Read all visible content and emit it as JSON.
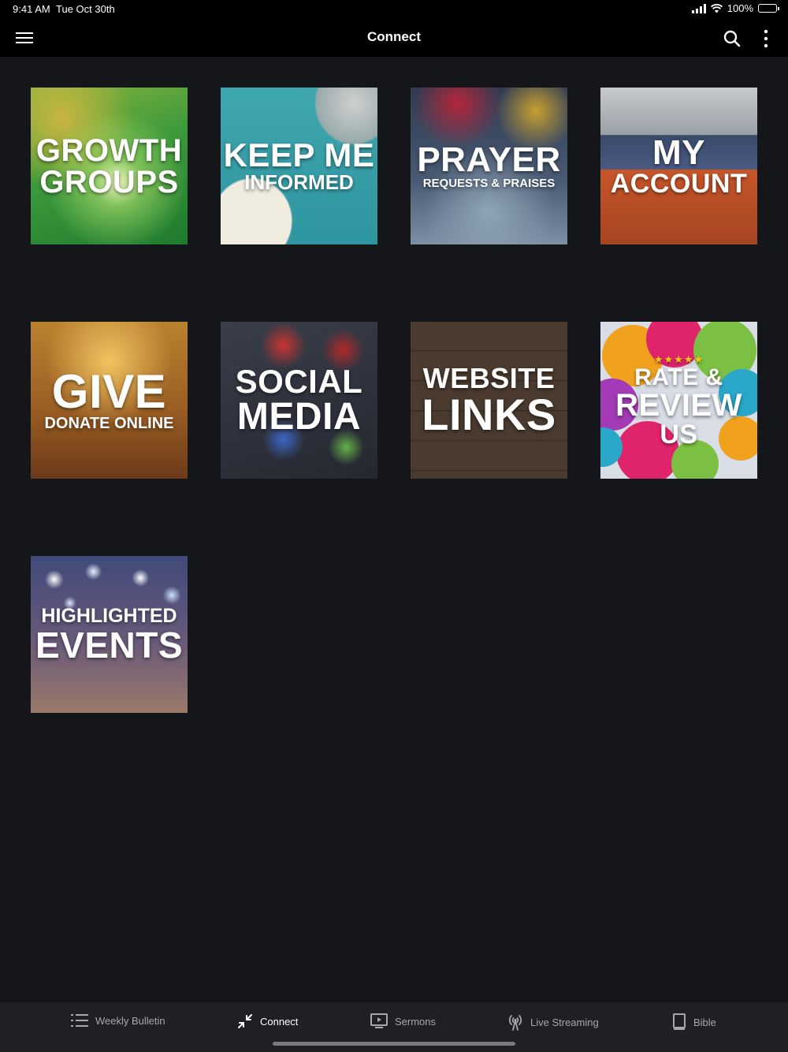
{
  "status_bar": {
    "time": "9:41 AM",
    "date": "Tue Oct 30th",
    "battery": "100%"
  },
  "nav": {
    "title": "Connect",
    "icons": [
      "menu-icon",
      "search-icon",
      "more-vertical-icon"
    ]
  },
  "tiles": [
    {
      "line1": "GROWTH",
      "line2": "GROUPS"
    },
    {
      "line1": "KEEP ME",
      "line2": "INFORMED"
    },
    {
      "line1": "PRAYER",
      "line2": "REQUESTS & PRAISES"
    },
    {
      "line1": "MY",
      "line2": "ACCOUNT"
    },
    {
      "line1": "GIVE",
      "line2": "DONATE ONLINE"
    },
    {
      "line1": "SOCIAL",
      "line2": "MEDIA"
    },
    {
      "line1": "WEBSITE",
      "line2": "LINKS"
    },
    {
      "stars": "★★★★★",
      "line1": "RATE &",
      "line2": "REVIEW",
      "line3": "US"
    },
    {
      "line1": "HIGHLIGHTED",
      "line2": "EVENTS"
    }
  ],
  "tab_bar": {
    "active": "Connect",
    "tabs": [
      {
        "label": "Weekly Bulletin",
        "icon": "list-icon"
      },
      {
        "label": "Connect",
        "icon": "connect-arrows-icon"
      },
      {
        "label": "Sermons",
        "icon": "play-screen-icon"
      },
      {
        "label": "Live Streaming",
        "icon": "broadcast-icon"
      },
      {
        "label": "Bible",
        "icon": "book-icon"
      }
    ]
  },
  "colors": {
    "background": "#151619",
    "bar": "#000000",
    "tab_bar": "#1f2023",
    "tab_inactive": "#a7a8ab"
  }
}
